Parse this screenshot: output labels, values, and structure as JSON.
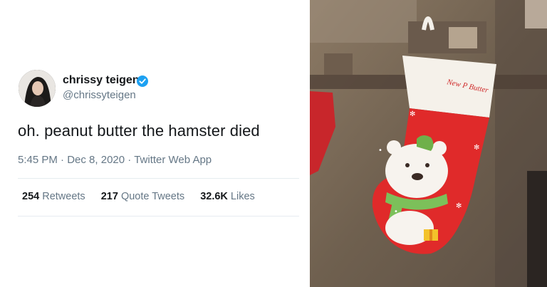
{
  "tweet": {
    "author": {
      "name": "chrissy teigen",
      "handle": "@chrissyteigen",
      "verified_color": "#1DA1F2"
    },
    "text": "oh. peanut butter the hamster died",
    "time": "5:45 PM",
    "date": "Dec 8, 2020",
    "client": "Twitter Web App",
    "separator": "·",
    "stats": {
      "retweets_count": "254",
      "retweets_label": "Retweets",
      "quotes_count": "217",
      "quotes_label": "Quote Tweets",
      "likes_count": "32.6K",
      "likes_label": "Likes"
    }
  },
  "photo": {
    "stocking_text": "New P Butter",
    "colors": {
      "stocking_red": "#e02a2a",
      "cuff_white": "#f5f1ea",
      "wall": "#7d6b57"
    }
  }
}
